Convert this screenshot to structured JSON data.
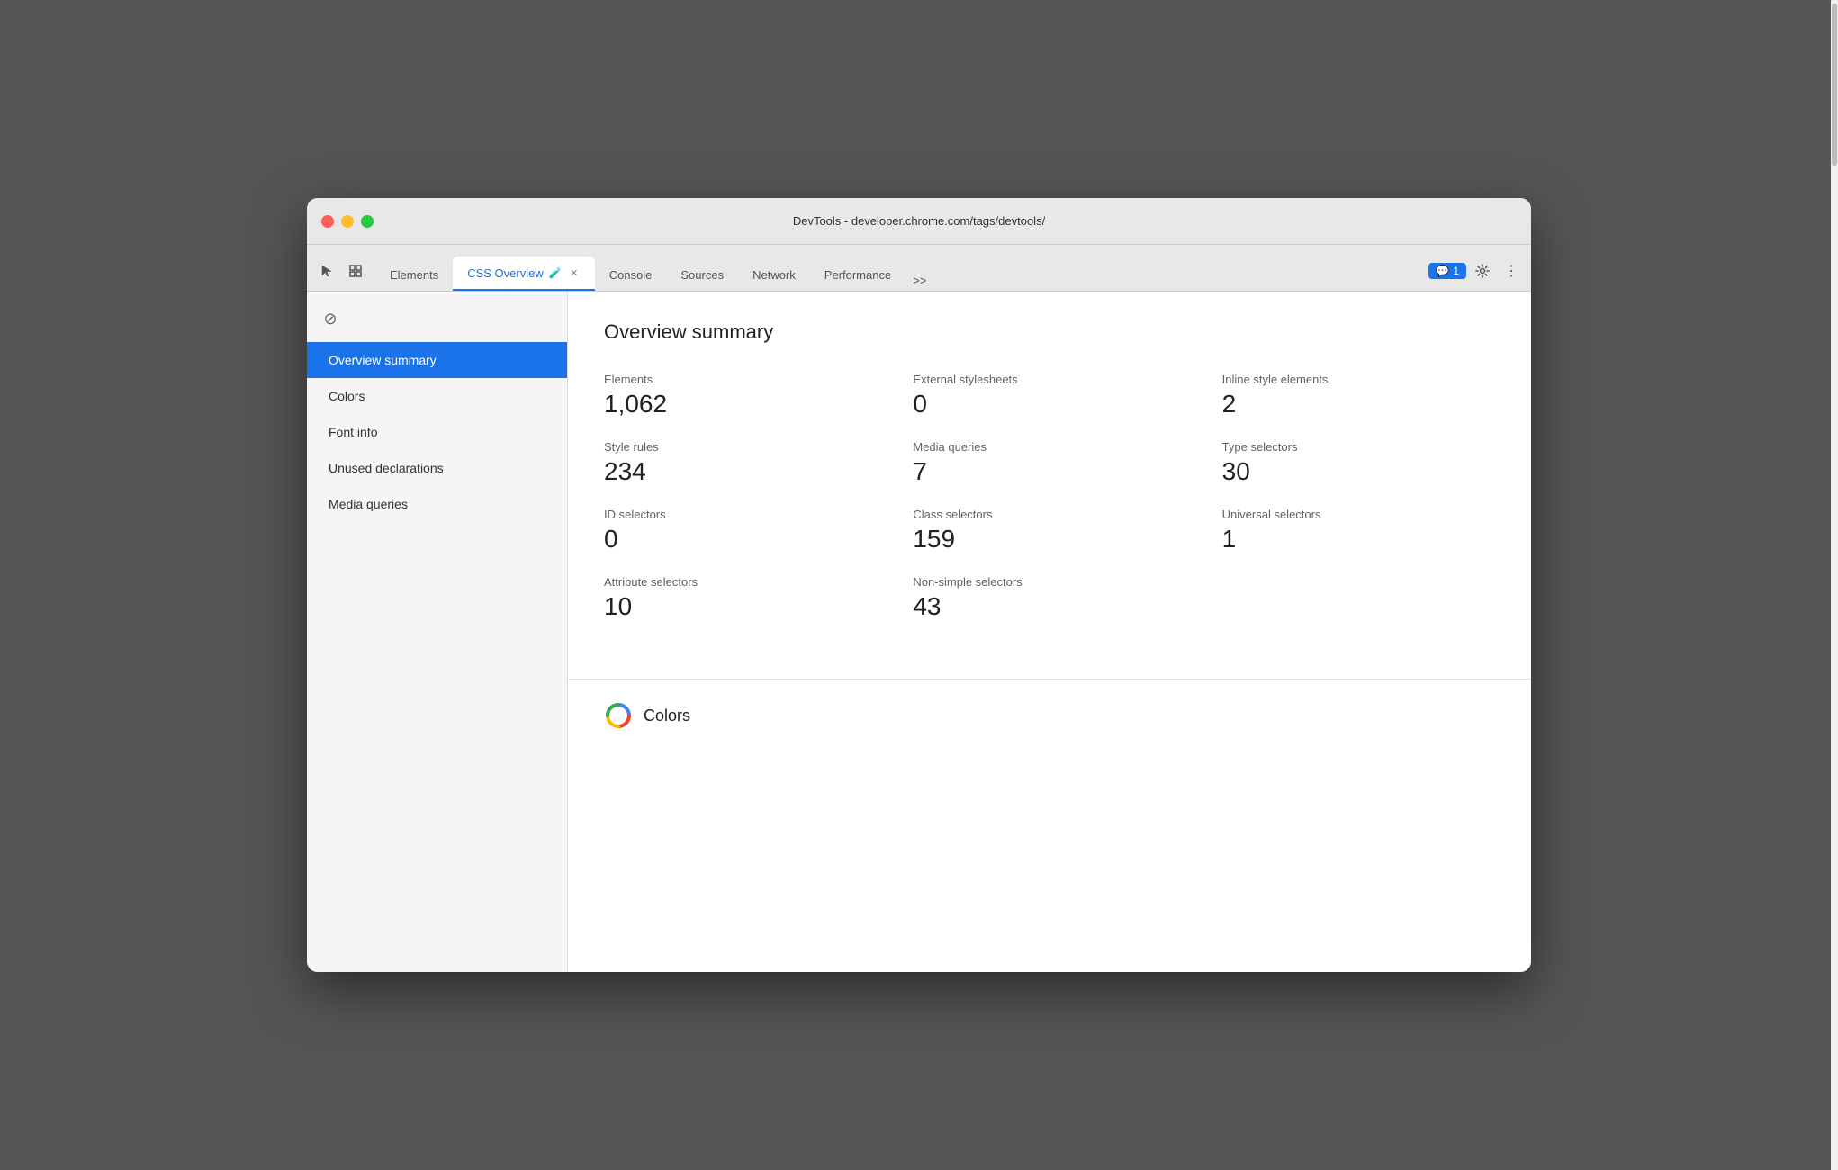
{
  "window": {
    "title": "DevTools - developer.chrome.com/tags/devtools/"
  },
  "tabs": [
    {
      "id": "elements",
      "label": "Elements",
      "active": false
    },
    {
      "id": "css-overview",
      "label": "CSS Overview",
      "active": true,
      "has_experiment": true,
      "closeable": true
    },
    {
      "id": "console",
      "label": "Console",
      "active": false
    },
    {
      "id": "sources",
      "label": "Sources",
      "active": false
    },
    {
      "id": "network",
      "label": "Network",
      "active": false
    },
    {
      "id": "performance",
      "label": "Performance",
      "active": false
    }
  ],
  "more_tabs_label": ">>",
  "notification": {
    "icon": "💬",
    "count": "1"
  },
  "sidebar": {
    "items": [
      {
        "id": "overview-summary",
        "label": "Overview summary",
        "active": true
      },
      {
        "id": "colors",
        "label": "Colors",
        "active": false
      },
      {
        "id": "font-info",
        "label": "Font info",
        "active": false
      },
      {
        "id": "unused-declarations",
        "label": "Unused declarations",
        "active": false
      },
      {
        "id": "media-queries",
        "label": "Media queries",
        "active": false
      }
    ]
  },
  "main": {
    "title": "Overview summary",
    "stats": [
      {
        "label": "Elements",
        "value": "1,062"
      },
      {
        "label": "External stylesheets",
        "value": "0"
      },
      {
        "label": "Inline style elements",
        "value": "2"
      },
      {
        "label": "Style rules",
        "value": "234"
      },
      {
        "label": "Media queries",
        "value": "7"
      },
      {
        "label": "Type selectors",
        "value": "30"
      },
      {
        "label": "ID selectors",
        "value": "0"
      },
      {
        "label": "Class selectors",
        "value": "159"
      },
      {
        "label": "Universal selectors",
        "value": "1"
      },
      {
        "label": "Attribute selectors",
        "value": "10"
      },
      {
        "label": "Non-simple selectors",
        "value": "43"
      }
    ],
    "colors_section_title": "Colors"
  }
}
